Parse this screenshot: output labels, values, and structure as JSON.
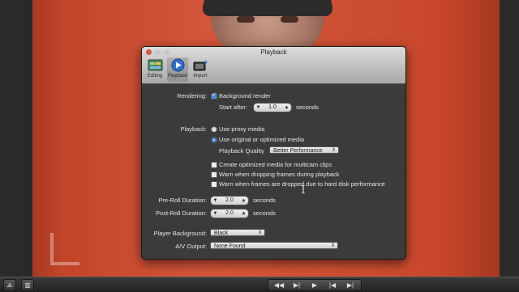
{
  "dialog": {
    "title": "Playback",
    "tabs": [
      {
        "label": "Editing",
        "icon": "editing-icon"
      },
      {
        "label": "Playback",
        "icon": "playback-icon"
      },
      {
        "label": "Import",
        "icon": "import-icon"
      }
    ]
  },
  "rendering": {
    "label": "Rendering:",
    "background_render_label": "Background render",
    "background_render_checked": true,
    "start_after_label": "Start after:",
    "start_after_value": "1.0",
    "start_after_unit": "seconds"
  },
  "playback": {
    "label": "Playback:",
    "proxy_label": "Use proxy media",
    "original_label": "Use original or optimized media",
    "selected": "original",
    "quality_label": "Playback Quality",
    "quality_value": "Better Performance"
  },
  "options": [
    {
      "label": "Create optimized media for multicam clips",
      "checked": false
    },
    {
      "label": "Warn when dropping frames during playback",
      "checked": false
    },
    {
      "label": "Warn when frames are dropped due to hard disk performance",
      "checked": false
    }
  ],
  "preroll": {
    "label": "Pre-Roll Duration:",
    "value": "2.0",
    "unit": "seconds"
  },
  "postroll": {
    "label": "Post-Roll Duration:",
    "value": "2.0",
    "unit": "seconds"
  },
  "player_background": {
    "label": "Player Background:",
    "value": "Black"
  },
  "av_output": {
    "label": "A/V Output:",
    "value": "None Found"
  },
  "colors": {
    "accent": "#3e7fd8",
    "dialog_bg": "#3b3b3b",
    "backdrop": "#cf5234"
  }
}
